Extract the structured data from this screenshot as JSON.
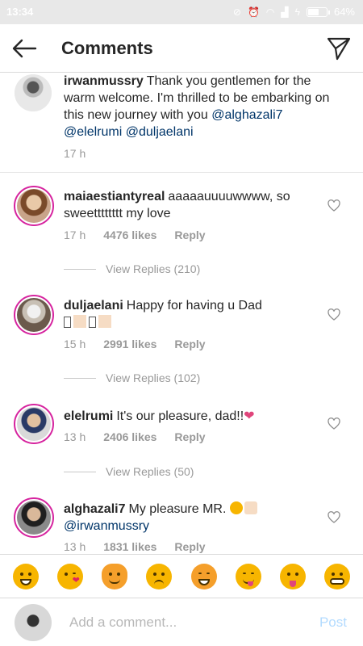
{
  "status_bar": {
    "time": "13:34",
    "battery_label": "64%",
    "battery_level": 0.64,
    "icons": [
      "mute-icon",
      "alarm-icon",
      "wifi-icon",
      "signal-icon",
      "charging-icon"
    ]
  },
  "header": {
    "title": "Comments",
    "back_icon": "back-arrow-icon",
    "send_icon": "direct-send-icon"
  },
  "caption": {
    "username": "irwanmussry",
    "text": "Thank you gentlemen for the warm welcome. I'm thrilled to be embarking on this new journey with you",
    "mentions": [
      "@alghazali7",
      "@elelrumi",
      "@duljaelani"
    ],
    "time": "17 h"
  },
  "comments": [
    {
      "username": "maiaestiantyreal",
      "text": "aaaaauuuuwwww, so sweetttttttt my love",
      "time": "17 h",
      "likes": "4476 likes",
      "reply": "Reply",
      "view_replies": "View Replies (210)"
    },
    {
      "username": "duljaelani",
      "text": "Happy for having u Dad",
      "time": "15 h",
      "likes": "2991 likes",
      "reply": "Reply",
      "view_replies": "View Replies (102)"
    },
    {
      "username": "elelrumi",
      "text": "It's our pleasure, dad!!",
      "time": "13 h",
      "likes": "2406 likes",
      "reply": "Reply",
      "view_replies": "View Replies (50)"
    },
    {
      "username": "alghazali7",
      "text": "My pleasure MR.",
      "mention": "@irwanmussry",
      "time": "13 h",
      "likes": "1831 likes",
      "reply": "Reply"
    }
  ],
  "emoji_bar": [
    "grinning-face",
    "kissing-wink-face",
    "cat-face",
    "worried-face",
    "laughing-face",
    "yum-face",
    "tongue-face",
    "grimacing-face"
  ],
  "input": {
    "placeholder": "Add a comment...",
    "post_label": "Post"
  },
  "colors": {
    "mention": "#003569",
    "muted": "#999999",
    "post_disabled": "#b3dbff",
    "story_ring": "#d6249f"
  }
}
